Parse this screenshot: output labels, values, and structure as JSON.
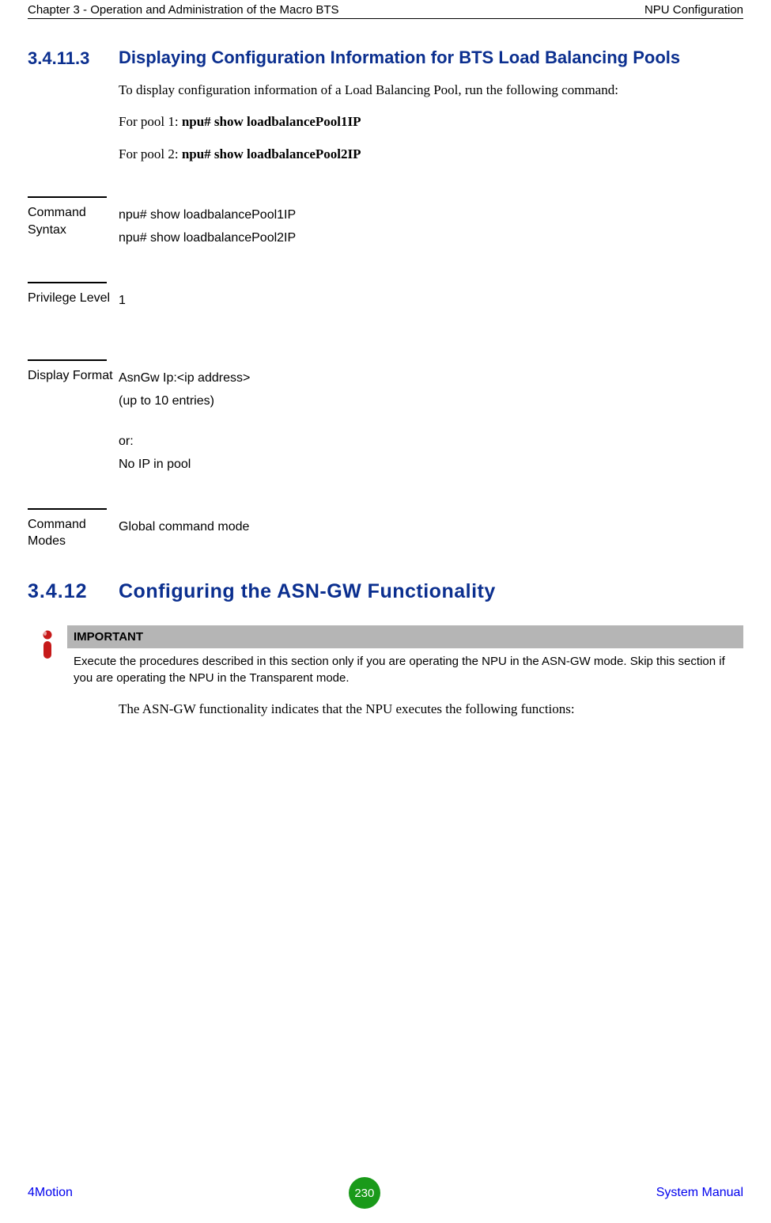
{
  "header": {
    "left": "Chapter 3 - Operation and Administration of the Macro BTS",
    "right": "NPU Configuration"
  },
  "section": {
    "num": "3.4.11.3",
    "title": "Displaying Configuration Information for BTS Load Balancing Pools",
    "intro": "To display configuration information of a Load Balancing Pool, run the following command:",
    "pool1": {
      "prefix": "For pool 1: ",
      "cmd": "npu# show loadbalancePool1IP"
    },
    "pool2": {
      "prefix": "For pool 2: ",
      "cmd": "npu# show loadbalancePool2IP"
    }
  },
  "defs": {
    "syntax": {
      "label": "Command Syntax",
      "line1": "npu# show loadbalancePool1IP",
      "line2": "npu# show loadbalancePool2IP"
    },
    "privilege": {
      "label": "Privilege Level",
      "value": "1"
    },
    "display": {
      "label": "Display Format",
      "line1": "AsnGw Ip:<ip address>",
      "line2": "(up to 10 entries)",
      "line3": "or:",
      "line4": " No IP in pool"
    },
    "modes": {
      "label": "Command Modes",
      "value": "Global command mode"
    }
  },
  "h2": {
    "num": "3.4.12",
    "title": "Configuring the ASN-GW Functionality"
  },
  "important": {
    "header": "IMPORTANT",
    "body": "Execute the procedures described in this section only if you are operating the NPU in the ASN-GW mode. Skip this section if you are operating the NPU in the Transparent mode."
  },
  "closing": "The ASN-GW functionality indicates that the NPU executes the following functions:",
  "footer": {
    "left": "4Motion",
    "page": "230",
    "right": "System Manual"
  }
}
